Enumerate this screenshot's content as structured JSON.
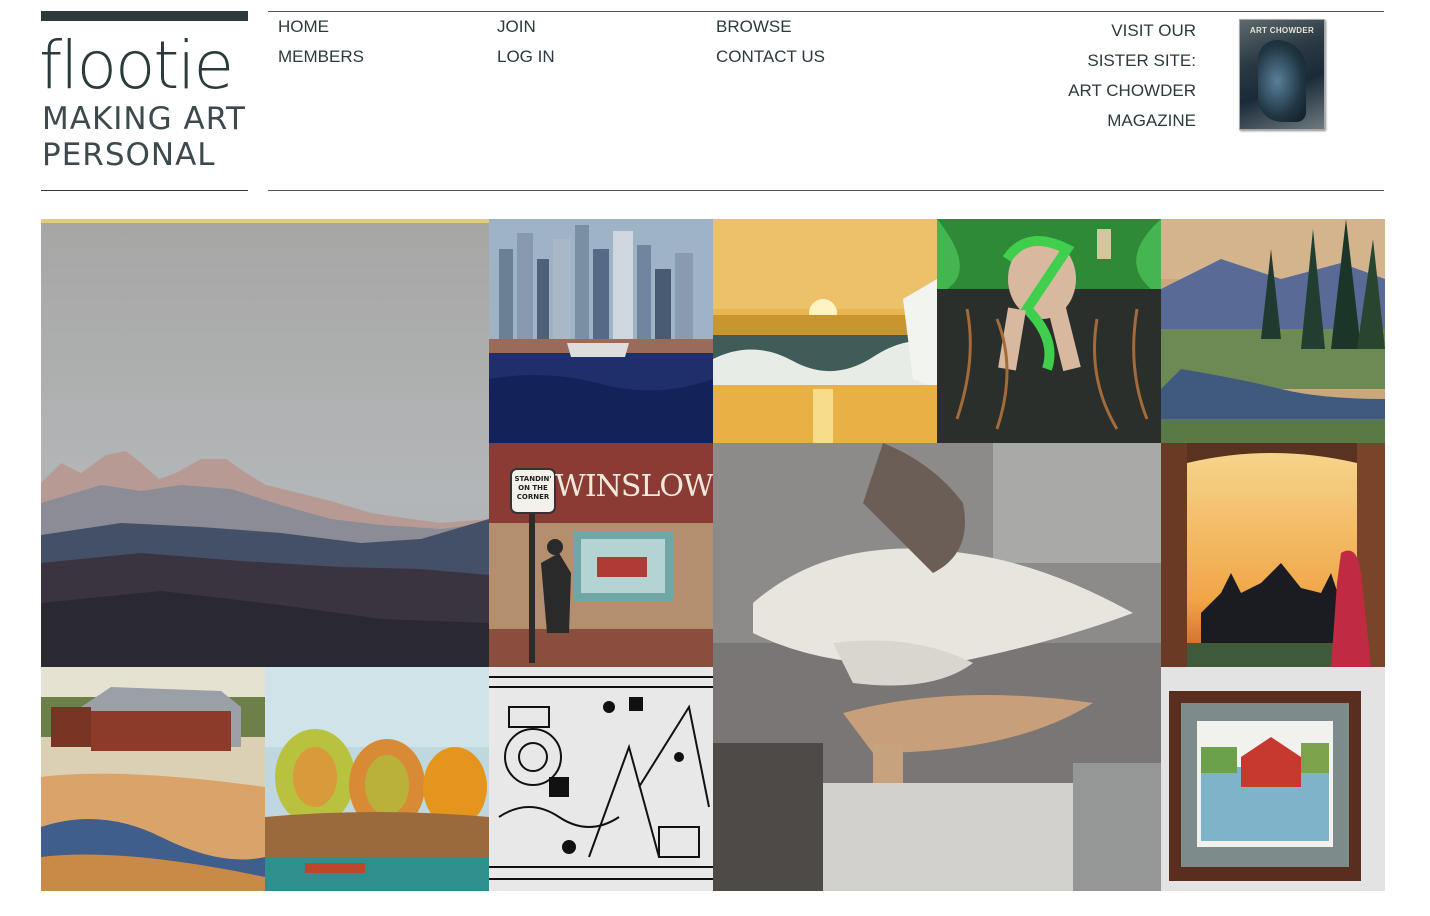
{
  "logo": {
    "wordmark": "flootie",
    "tagline_line1": "MAKING ART",
    "tagline_line2": "PERSONAL"
  },
  "nav": {
    "home": "HOME",
    "members": "MEMBERS",
    "join": "JOIN",
    "login": "LOG IN",
    "browse": "BROWSE",
    "contact": "CONTACT US"
  },
  "sister_site": {
    "line1": "VISIT OUR",
    "line2": "SISTER SITE:",
    "line3": "ART CHOWDER",
    "line4": "MAGAZINE",
    "cover_title": "ART CHOWDER"
  },
  "gallery": {
    "winslow_sign": "WINSLOW",
    "route_sign_line1": "STANDIN'",
    "route_sign_line2": "ON THE",
    "route_sign_line3": "CORNER"
  },
  "colors": {
    "accent": "#e1cb7f",
    "dark": "#2e3a3e"
  }
}
